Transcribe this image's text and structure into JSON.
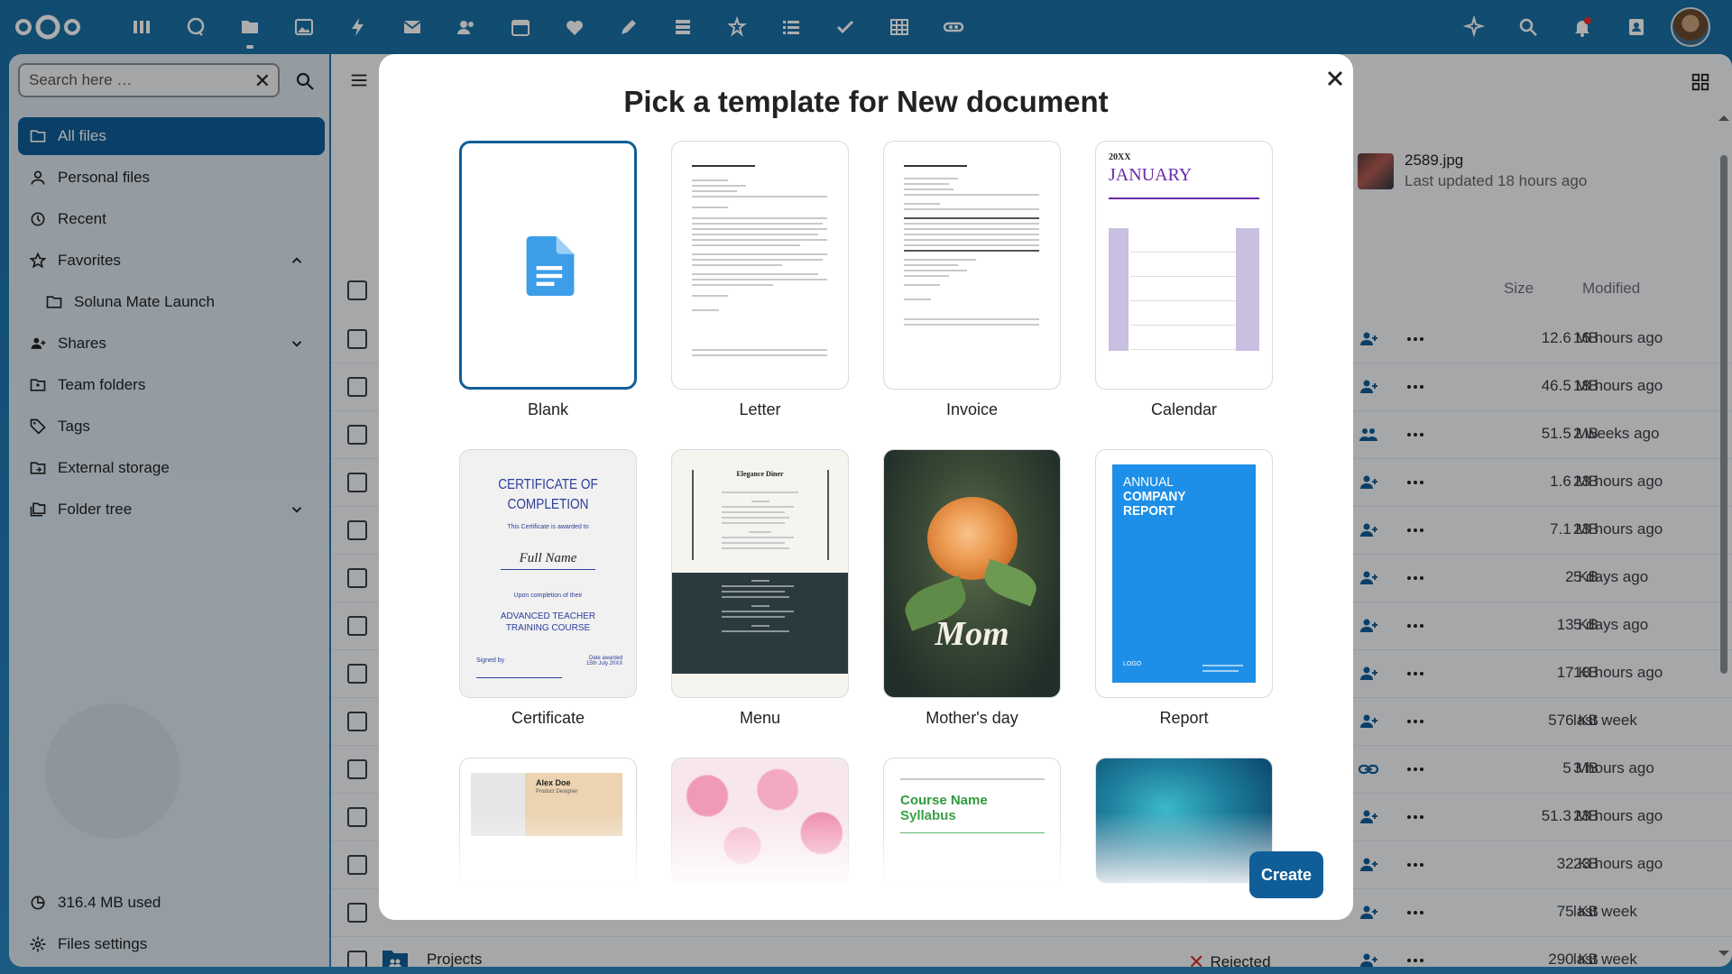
{
  "search": {
    "placeholder": "Search here …"
  },
  "sidebar": {
    "items": [
      {
        "label": "All files"
      },
      {
        "label": "Personal files"
      },
      {
        "label": "Recent"
      },
      {
        "label": "Favorites"
      },
      {
        "label": "Soluna Mate Launch"
      },
      {
        "label": "Shares"
      },
      {
        "label": "Team folders"
      },
      {
        "label": "Tags"
      },
      {
        "label": "External storage"
      },
      {
        "label": "Folder tree"
      }
    ],
    "storage": "316.4 MB used",
    "settings": "Files settings"
  },
  "recent": {
    "name": "2589.jpg",
    "sub": "Last updated 18 hours ago"
  },
  "table": {
    "col_size": "Size",
    "col_modified": "Modified",
    "rows": [
      {
        "size": "12.6 MB",
        "modified": "16 hours ago"
      },
      {
        "size": "46.5 MB",
        "modified": "18 hours ago"
      },
      {
        "size": "51.5 MB",
        "modified": "2 weeks ago"
      },
      {
        "size": "1.6 MB",
        "modified": "23 hours ago"
      },
      {
        "size": "7.1 MB",
        "modified": "23 hours ago"
      },
      {
        "size": "2 KB",
        "modified": "5 days ago"
      },
      {
        "size": "13 KB",
        "modified": "5 days ago"
      },
      {
        "size": "17 KB",
        "modified": "18 hours ago"
      },
      {
        "size": "576 KB",
        "modified": "last week"
      },
      {
        "size": "5 MB",
        "modified": "3 hours ago"
      },
      {
        "size": "51.3 MB",
        "modified": "23 hours ago"
      },
      {
        "size": "32 KB",
        "modified": "23 hours ago"
      },
      {
        "size": "75 KB",
        "modified": "last week"
      },
      {
        "name": "Projects",
        "status": "Rejected",
        "size": "290 KB",
        "modified": "last week"
      }
    ]
  },
  "modal": {
    "title": "Pick a template for New document",
    "create": "Create",
    "templates": [
      {
        "label": "Blank"
      },
      {
        "label": "Letter"
      },
      {
        "label": "Invoice"
      },
      {
        "label": "Calendar"
      },
      {
        "label": "Certificate"
      },
      {
        "label": "Menu"
      },
      {
        "label": "Mother's day"
      },
      {
        "label": "Report"
      }
    ],
    "previews": {
      "calendar_year": "20XX",
      "calendar_month": "JANUARY",
      "cert_title1": "CERTIFICATE OF",
      "cert_title2": "COMPLETION",
      "cert_line": "This Certificate is awarded to",
      "cert_name": "Full Name",
      "cert_upon": "Upon completion of their",
      "cert_course1": "ADVANCED TEACHER",
      "cert_course2": "TRAINING COURSE",
      "cert_signed": "Signed by",
      "cert_date": "Date awarded",
      "cert_date2": "15th July 20XX",
      "menu_title": "Elegance Diner",
      "mom_text": "Mom",
      "report_line1": "ANNUAL",
      "report_line2": "COMPANY",
      "report_line3": "REPORT",
      "report_logo": "LOGO",
      "card_name": "Alex Doe",
      "card_role": "Product Designer",
      "syllabus_line1": "Course Name",
      "syllabus_line2": "Syllabus"
    }
  },
  "colors": {
    "primary": "#0f5e98",
    "header": "#1a6fa6"
  }
}
